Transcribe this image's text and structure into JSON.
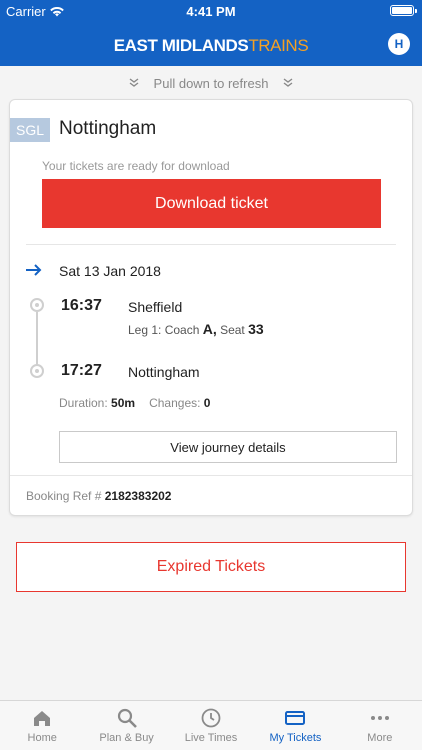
{
  "status": {
    "carrier": "Carrier",
    "time": "4:41 PM"
  },
  "header": {
    "brand_main": "EAST MIDLANDS",
    "brand_accent": "TRAINS",
    "avatar_initial": "H"
  },
  "refresh": {
    "label": "Pull down to refresh"
  },
  "ticket": {
    "type_badge": "SGL",
    "destination": "Nottingham",
    "ready_text": "Your tickets are ready for download",
    "download_label": "Download ticket",
    "date": "Sat 13 Jan 2018",
    "departure": {
      "time": "16:37",
      "station": "Sheffield"
    },
    "leg": {
      "prefix": "Leg 1: Coach",
      "coach": "A,",
      "seat_label": "Seat",
      "seat": "33"
    },
    "arrival": {
      "time": "17:27",
      "station": "Nottingham"
    },
    "duration_label": "Duration:",
    "duration": "50m",
    "changes_label": "Changes:",
    "changes": "0",
    "view_details_label": "View journey details",
    "booking_ref_label": "Booking Ref #",
    "booking_ref": "2182383202"
  },
  "expired_label": "Expired Tickets",
  "tabs": [
    {
      "label": "Home",
      "icon": "home-icon"
    },
    {
      "label": "Plan & Buy",
      "icon": "search-icon"
    },
    {
      "label": "Live Times",
      "icon": "clock-icon"
    },
    {
      "label": "My Tickets",
      "icon": "ticket-icon",
      "active": true
    },
    {
      "label": "More",
      "icon": "more-icon"
    }
  ],
  "colors": {
    "brand_blue": "#1462c4",
    "accent_red": "#e8372f",
    "brand_orange": "#f4a024"
  }
}
